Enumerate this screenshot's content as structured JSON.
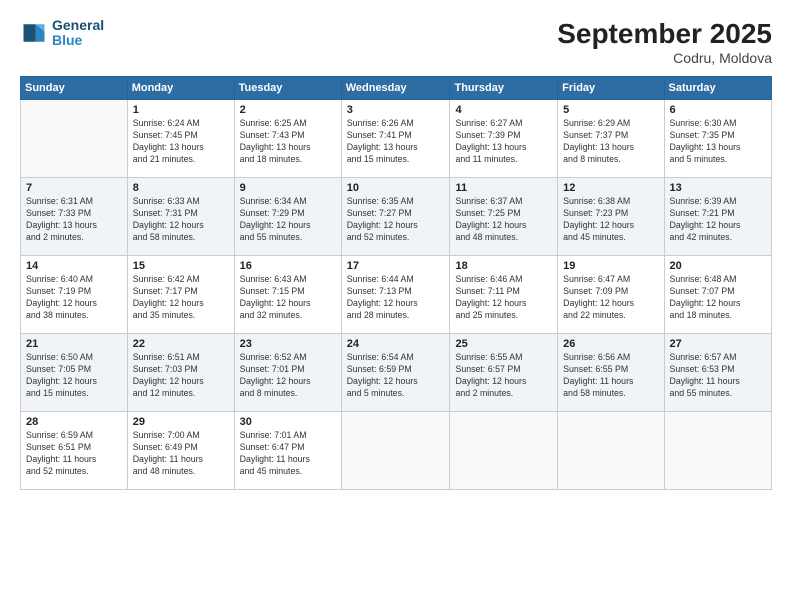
{
  "header": {
    "logo_line1": "General",
    "logo_line2": "Blue",
    "title": "September 2025",
    "location": "Codru, Moldova"
  },
  "days_of_week": [
    "Sunday",
    "Monday",
    "Tuesday",
    "Wednesday",
    "Thursday",
    "Friday",
    "Saturday"
  ],
  "weeks": [
    [
      {
        "day": "",
        "info": ""
      },
      {
        "day": "1",
        "info": "Sunrise: 6:24 AM\nSunset: 7:45 PM\nDaylight: 13 hours\nand 21 minutes."
      },
      {
        "day": "2",
        "info": "Sunrise: 6:25 AM\nSunset: 7:43 PM\nDaylight: 13 hours\nand 18 minutes."
      },
      {
        "day": "3",
        "info": "Sunrise: 6:26 AM\nSunset: 7:41 PM\nDaylight: 13 hours\nand 15 minutes."
      },
      {
        "day": "4",
        "info": "Sunrise: 6:27 AM\nSunset: 7:39 PM\nDaylight: 13 hours\nand 11 minutes."
      },
      {
        "day": "5",
        "info": "Sunrise: 6:29 AM\nSunset: 7:37 PM\nDaylight: 13 hours\nand 8 minutes."
      },
      {
        "day": "6",
        "info": "Sunrise: 6:30 AM\nSunset: 7:35 PM\nDaylight: 13 hours\nand 5 minutes."
      }
    ],
    [
      {
        "day": "7",
        "info": "Sunrise: 6:31 AM\nSunset: 7:33 PM\nDaylight: 13 hours\nand 2 minutes."
      },
      {
        "day": "8",
        "info": "Sunrise: 6:33 AM\nSunset: 7:31 PM\nDaylight: 12 hours\nand 58 minutes."
      },
      {
        "day": "9",
        "info": "Sunrise: 6:34 AM\nSunset: 7:29 PM\nDaylight: 12 hours\nand 55 minutes."
      },
      {
        "day": "10",
        "info": "Sunrise: 6:35 AM\nSunset: 7:27 PM\nDaylight: 12 hours\nand 52 minutes."
      },
      {
        "day": "11",
        "info": "Sunrise: 6:37 AM\nSunset: 7:25 PM\nDaylight: 12 hours\nand 48 minutes."
      },
      {
        "day": "12",
        "info": "Sunrise: 6:38 AM\nSunset: 7:23 PM\nDaylight: 12 hours\nand 45 minutes."
      },
      {
        "day": "13",
        "info": "Sunrise: 6:39 AM\nSunset: 7:21 PM\nDaylight: 12 hours\nand 42 minutes."
      }
    ],
    [
      {
        "day": "14",
        "info": "Sunrise: 6:40 AM\nSunset: 7:19 PM\nDaylight: 12 hours\nand 38 minutes."
      },
      {
        "day": "15",
        "info": "Sunrise: 6:42 AM\nSunset: 7:17 PM\nDaylight: 12 hours\nand 35 minutes."
      },
      {
        "day": "16",
        "info": "Sunrise: 6:43 AM\nSunset: 7:15 PM\nDaylight: 12 hours\nand 32 minutes."
      },
      {
        "day": "17",
        "info": "Sunrise: 6:44 AM\nSunset: 7:13 PM\nDaylight: 12 hours\nand 28 minutes."
      },
      {
        "day": "18",
        "info": "Sunrise: 6:46 AM\nSunset: 7:11 PM\nDaylight: 12 hours\nand 25 minutes."
      },
      {
        "day": "19",
        "info": "Sunrise: 6:47 AM\nSunset: 7:09 PM\nDaylight: 12 hours\nand 22 minutes."
      },
      {
        "day": "20",
        "info": "Sunrise: 6:48 AM\nSunset: 7:07 PM\nDaylight: 12 hours\nand 18 minutes."
      }
    ],
    [
      {
        "day": "21",
        "info": "Sunrise: 6:50 AM\nSunset: 7:05 PM\nDaylight: 12 hours\nand 15 minutes."
      },
      {
        "day": "22",
        "info": "Sunrise: 6:51 AM\nSunset: 7:03 PM\nDaylight: 12 hours\nand 12 minutes."
      },
      {
        "day": "23",
        "info": "Sunrise: 6:52 AM\nSunset: 7:01 PM\nDaylight: 12 hours\nand 8 minutes."
      },
      {
        "day": "24",
        "info": "Sunrise: 6:54 AM\nSunset: 6:59 PM\nDaylight: 12 hours\nand 5 minutes."
      },
      {
        "day": "25",
        "info": "Sunrise: 6:55 AM\nSunset: 6:57 PM\nDaylight: 12 hours\nand 2 minutes."
      },
      {
        "day": "26",
        "info": "Sunrise: 6:56 AM\nSunset: 6:55 PM\nDaylight: 11 hours\nand 58 minutes."
      },
      {
        "day": "27",
        "info": "Sunrise: 6:57 AM\nSunset: 6:53 PM\nDaylight: 11 hours\nand 55 minutes."
      }
    ],
    [
      {
        "day": "28",
        "info": "Sunrise: 6:59 AM\nSunset: 6:51 PM\nDaylight: 11 hours\nand 52 minutes."
      },
      {
        "day": "29",
        "info": "Sunrise: 7:00 AM\nSunset: 6:49 PM\nDaylight: 11 hours\nand 48 minutes."
      },
      {
        "day": "30",
        "info": "Sunrise: 7:01 AM\nSunset: 6:47 PM\nDaylight: 11 hours\nand 45 minutes."
      },
      {
        "day": "",
        "info": ""
      },
      {
        "day": "",
        "info": ""
      },
      {
        "day": "",
        "info": ""
      },
      {
        "day": "",
        "info": ""
      }
    ]
  ]
}
